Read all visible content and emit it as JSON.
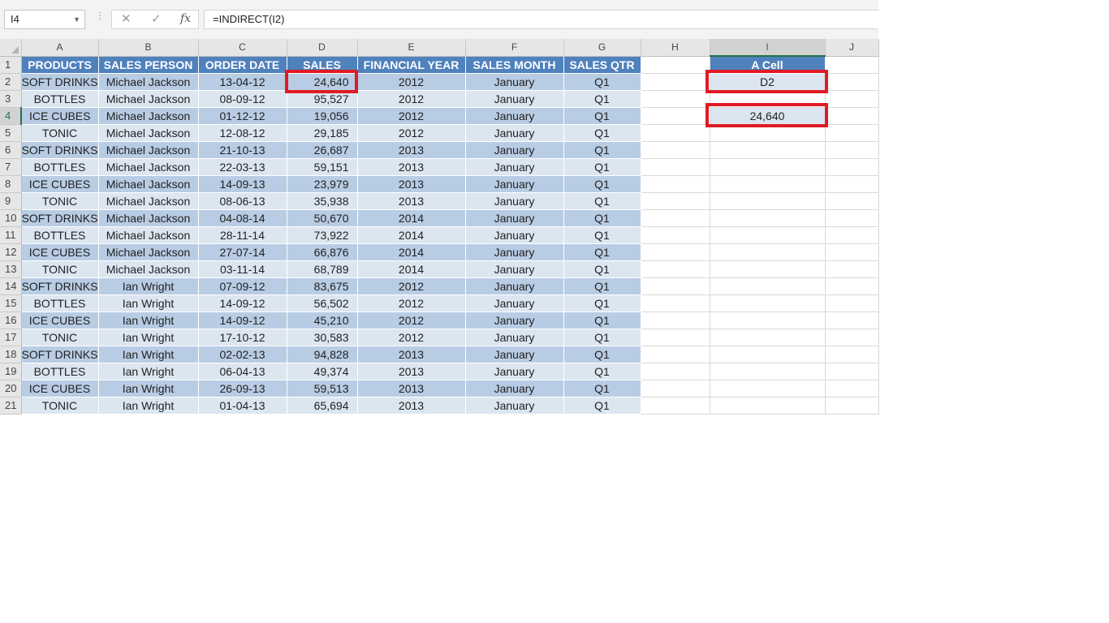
{
  "formula_bar": {
    "name_box": "I4",
    "cancel_icon": "✕",
    "enter_icon": "✓",
    "fx_label": "fx",
    "formula": "=INDIRECT(I2)"
  },
  "columns": [
    "A",
    "B",
    "C",
    "D",
    "E",
    "F",
    "G",
    "H",
    "I",
    "J"
  ],
  "headers": {
    "A": "PRODUCTS",
    "B": "SALES PERSON",
    "C": "ORDER DATE",
    "D": "SALES",
    "E": "FINANCIAL YEAR",
    "F": "SALES MONTH",
    "G": "SALES QTR",
    "I": "A Cell"
  },
  "rows": [
    [
      "SOFT DRINKS",
      "Michael Jackson",
      "13-04-12",
      "24,640",
      "2012",
      "January",
      "Q1"
    ],
    [
      "BOTTLES",
      "Michael Jackson",
      "08-09-12",
      "95,527",
      "2012",
      "January",
      "Q1"
    ],
    [
      "ICE CUBES",
      "Michael Jackson",
      "01-12-12",
      "19,056",
      "2012",
      "January",
      "Q1"
    ],
    [
      "TONIC",
      "Michael Jackson",
      "12-08-12",
      "29,185",
      "2012",
      "January",
      "Q1"
    ],
    [
      "SOFT DRINKS",
      "Michael Jackson",
      "21-10-13",
      "26,687",
      "2013",
      "January",
      "Q1"
    ],
    [
      "BOTTLES",
      "Michael Jackson",
      "22-03-13",
      "59,151",
      "2013",
      "January",
      "Q1"
    ],
    [
      "ICE CUBES",
      "Michael Jackson",
      "14-09-13",
      "23,979",
      "2013",
      "January",
      "Q1"
    ],
    [
      "TONIC",
      "Michael Jackson",
      "08-06-13",
      "35,938",
      "2013",
      "January",
      "Q1"
    ],
    [
      "SOFT DRINKS",
      "Michael Jackson",
      "04-08-14",
      "50,670",
      "2014",
      "January",
      "Q1"
    ],
    [
      "BOTTLES",
      "Michael Jackson",
      "28-11-14",
      "73,922",
      "2014",
      "January",
      "Q1"
    ],
    [
      "ICE CUBES",
      "Michael Jackson",
      "27-07-14",
      "66,876",
      "2014",
      "January",
      "Q1"
    ],
    [
      "TONIC",
      "Michael Jackson",
      "03-11-14",
      "68,789",
      "2014",
      "January",
      "Q1"
    ],
    [
      "SOFT DRINKS",
      "Ian Wright",
      "07-09-12",
      "83,675",
      "2012",
      "January",
      "Q1"
    ],
    [
      "BOTTLES",
      "Ian Wright",
      "14-09-12",
      "56,502",
      "2012",
      "January",
      "Q1"
    ],
    [
      "ICE CUBES",
      "Ian Wright",
      "14-09-12",
      "45,210",
      "2012",
      "January",
      "Q1"
    ],
    [
      "TONIC",
      "Ian Wright",
      "17-10-12",
      "30,583",
      "2012",
      "January",
      "Q1"
    ],
    [
      "SOFT DRINKS",
      "Ian Wright",
      "02-02-13",
      "94,828",
      "2013",
      "January",
      "Q1"
    ],
    [
      "BOTTLES",
      "Ian Wright",
      "06-04-13",
      "49,374",
      "2013",
      "January",
      "Q1"
    ],
    [
      "ICE CUBES",
      "Ian Wright",
      "26-09-13",
      "59,513",
      "2013",
      "January",
      "Q1"
    ],
    [
      "TONIC",
      "Ian Wright",
      "01-04-13",
      "65,694",
      "2013",
      "January",
      "Q1"
    ]
  ],
  "i_column": {
    "I2": "D2",
    "I4": "24,640"
  },
  "selected_cell": "I4",
  "colors": {
    "header_fill": "#4f81bd",
    "band_dark": "#b8cce4",
    "band_light": "#dce6f1",
    "highlight": "#e01b24",
    "excel_green": "#217346"
  }
}
